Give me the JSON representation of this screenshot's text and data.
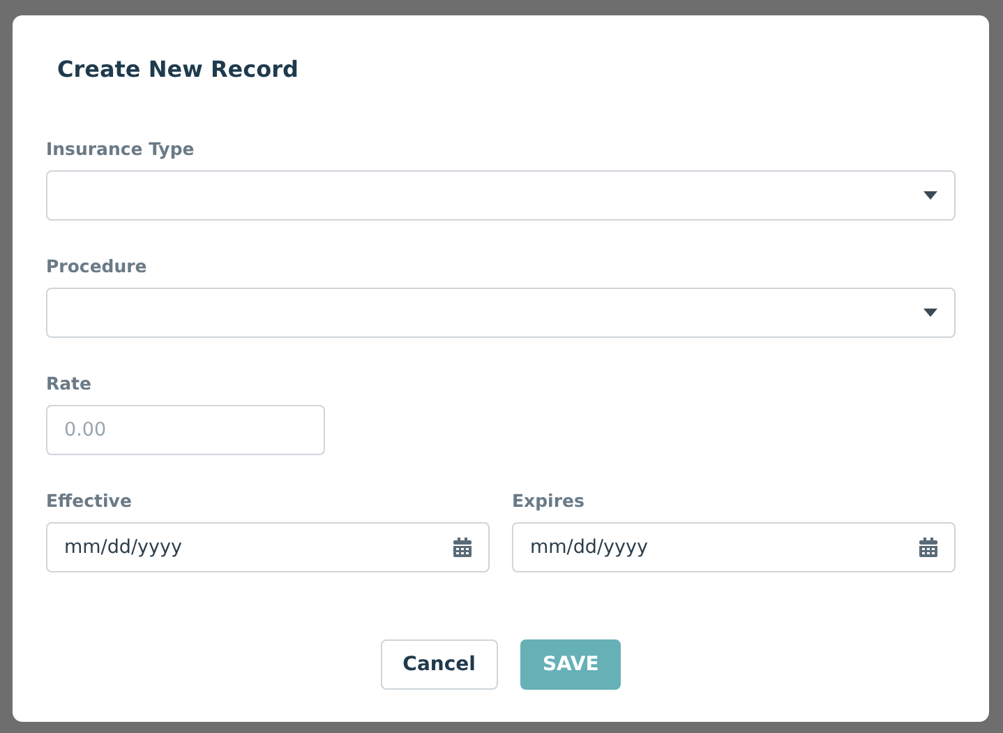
{
  "dialog": {
    "title": "Create New Record",
    "rows": [
      [
        {
          "kind": "select",
          "label": "Insurance Type"
        }
      ],
      [
        {
          "kind": "select",
          "label": "Procedure"
        }
      ],
      [
        {
          "kind": "number",
          "label": "Rate",
          "placeholder": "0.00"
        }
      ],
      [
        {
          "kind": "date",
          "label": "Effective",
          "placeholder": "mm/dd/yyyy"
        },
        {
          "kind": "date",
          "label": "Expires",
          "placeholder": "mm/dd/yyyy"
        }
      ]
    ],
    "buttons": [
      {
        "kind": "secondary",
        "label": "Cancel"
      },
      {
        "kind": "primary",
        "label": "SAVE"
      }
    ]
  }
}
